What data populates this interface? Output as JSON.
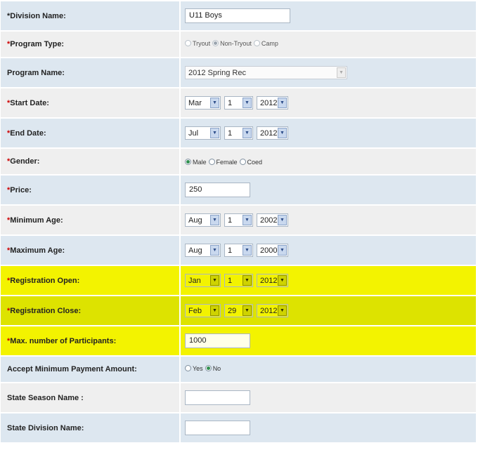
{
  "fields": {
    "division_name": {
      "label": "Division Name:",
      "value": "U11 Boys"
    },
    "program_type": {
      "label": "Program Type:",
      "options": [
        "Tryout",
        "Non-Tryout",
        "Camp"
      ],
      "selected": "Non-Tryout"
    },
    "program_name": {
      "label": "Program Name:",
      "value": "2012 Spring Rec"
    },
    "start_date": {
      "label": "Start Date:",
      "month": "Mar",
      "day": "1",
      "year": "2012"
    },
    "end_date": {
      "label": "End Date:",
      "month": "Jul",
      "day": "1",
      "year": "2012"
    },
    "gender": {
      "label": "Gender:",
      "options": [
        "Male",
        "Female",
        "Coed"
      ],
      "selected": "Male"
    },
    "price": {
      "label": "Price:",
      "value": "250"
    },
    "minimum_age": {
      "label": "Minimum Age:",
      "month": "Aug",
      "day": "1",
      "year": "2002"
    },
    "maximum_age": {
      "label": "Maximum Age:",
      "month": "Aug",
      "day": "1",
      "year": "2000"
    },
    "registration_open": {
      "label": "Registration Open:",
      "month": "Jan",
      "day": "1",
      "year": "2012"
    },
    "registration_close": {
      "label": "Registration Close:",
      "month": "Feb",
      "day": "29",
      "year": "2012"
    },
    "max_participants": {
      "label": "Max. number of Participants:",
      "value": "1000"
    },
    "accept_min_payment": {
      "label": "Accept Minimum Payment Amount:",
      "options": [
        "Yes",
        "No"
      ],
      "selected": "No"
    },
    "state_season_name": {
      "label": "State Season Name :",
      "value": ""
    },
    "state_division_name": {
      "label": "State Division Name:",
      "value": ""
    }
  },
  "required_marker": "*",
  "colors": {
    "row_blue": "#dde7f0",
    "row_gray": "#efefef",
    "highlight_yellow": "#f3f300",
    "highlight_yellow_dark": "#dde300",
    "required_marker": "#cc0000"
  },
  "icons": {
    "select_arrow": "chevron-down-icon",
    "radio": "radio-icon"
  }
}
